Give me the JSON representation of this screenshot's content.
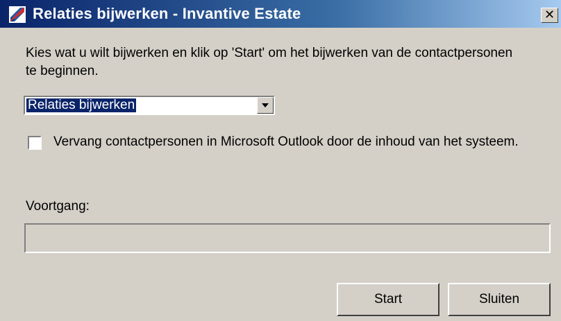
{
  "window": {
    "title": "Relaties bijwerken - Invantive Estate",
    "close_glyph": "✕",
    "icon": "pencil-app-icon",
    "colors": {
      "titlebar_start": "#0a246a",
      "titlebar_end": "#a6caf0",
      "face": "#d4d0c8",
      "selection": "#0a246a"
    }
  },
  "instruction": "Kies wat u wilt bijwerken en klik op 'Start' om het bijwerken van de contactpersonen te beginnen.",
  "update_select": {
    "selected": "Relaties bijwerken"
  },
  "replace_checkbox": {
    "checked": false,
    "label": "Vervang contactpersonen in Microsoft Outlook door de inhoud van het systeem."
  },
  "progress": {
    "label": "Voortgang:",
    "value": 0
  },
  "buttons": {
    "start": "Start",
    "close": "Sluiten"
  }
}
